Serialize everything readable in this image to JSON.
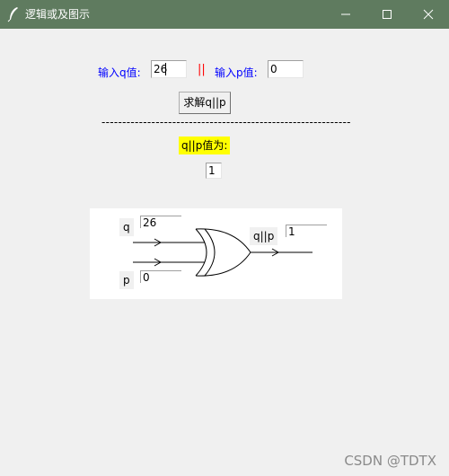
{
  "window": {
    "title": "逻辑或及图示",
    "icon": "feather-icon",
    "controls": [
      "minimize-icon",
      "maximize-icon",
      "close-icon"
    ]
  },
  "inputs": {
    "q_label": "输入q值:",
    "q_value": "26",
    "operator": "||",
    "p_label": "输入p值:",
    "p_value": "0"
  },
  "actions": {
    "solve_label": "求解q||p"
  },
  "separator": "------------------------------------------------------------",
  "result": {
    "label": "q||p值为:",
    "value": "1"
  },
  "diagram": {
    "q_tag": "q",
    "q_value": "26",
    "p_tag": "p",
    "p_value": "0",
    "out_tag": "q||p",
    "out_value": "1",
    "gate": "or-gate"
  },
  "watermark": "CSDN @TDTX",
  "colors": {
    "titlebar": "#5f7b5f",
    "label_text": "#0000ff",
    "operator": "#ff0000",
    "highlight": "#ffff00"
  }
}
